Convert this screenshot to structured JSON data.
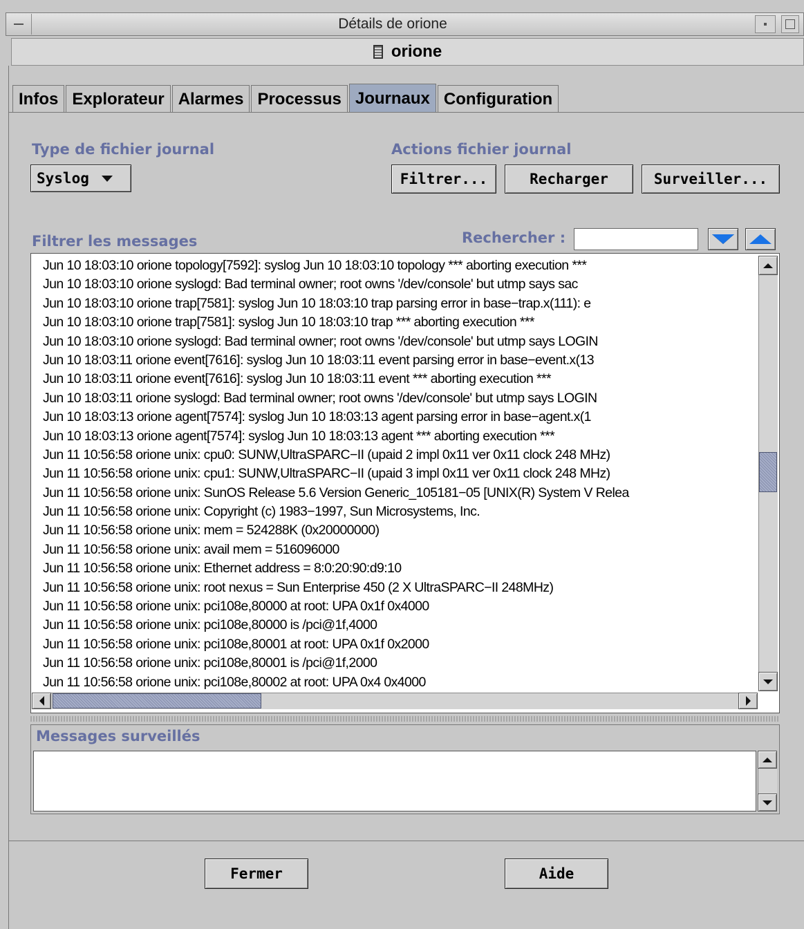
{
  "window": {
    "title": "Détails de orione",
    "host_name": "orione",
    "host_icon": "host-icon"
  },
  "tabs": [
    {
      "label": "Infos",
      "active": false
    },
    {
      "label": "Explorateur",
      "active": false
    },
    {
      "label": "Alarmes",
      "active": false
    },
    {
      "label": "Processus",
      "active": false
    },
    {
      "label": "Journaux",
      "active": true
    },
    {
      "label": "Configuration",
      "active": false
    }
  ],
  "log_type": {
    "label": "Type de fichier journal",
    "selected": "Syslog"
  },
  "log_actions": {
    "label": "Actions fichier journal",
    "filter": "Filtrer...",
    "reload": "Recharger",
    "watch": "Surveiller..."
  },
  "filter_messages": {
    "label": "Filtrer les messages",
    "search_label": "Rechercher :",
    "search_value": ""
  },
  "log_lines": [
    "Jun 10 18:03:10 orione topology[7592]: syslog  Jun 10 18:03:10 topology     *** aborting execution ***",
    "Jun 10 18:03:10 orione syslogd: Bad terminal owner; root owns '/dev/console' but utmp says sac",
    "Jun 10 18:03:10 orione trap[7581]: syslog  Jun 10 18:03:10 trap        parsing error in base−trap.x(111): e",
    "Jun 10 18:03:10 orione trap[7581]: syslog  Jun 10 18:03:10 trap        *** aborting execution ***",
    "Jun 10 18:03:10 orione syslogd: Bad terminal owner; root owns '/dev/console' but utmp says LOGIN",
    "Jun 10 18:03:11 orione event[7616]: syslog  Jun 10 18:03:11 event       parsing error in base−event.x(13",
    "Jun 10 18:03:11 orione event[7616]: syslog  Jun 10 18:03:11 event       *** aborting execution ***",
    "Jun 10 18:03:11 orione syslogd: Bad terminal owner; root owns '/dev/console' but utmp says LOGIN",
    "Jun 10 18:03:13 orione agent[7574]: syslog  Jun 10 18:03:13 agent       parsing error in base−agent.x(1",
    "Jun 10 18:03:13 orione agent[7574]: syslog  Jun 10 18:03:13 agent       *** aborting execution ***",
    "Jun 11 10:56:58 orione unix: cpu0: SUNW,UltraSPARC−II (upaid 2 impl 0x11 ver 0x11 clock 248 MHz)",
    "Jun 11 10:56:58 orione unix: cpu1: SUNW,UltraSPARC−II (upaid 3 impl 0x11 ver 0x11 clock 248 MHz)",
    "Jun 11 10:56:58 orione unix: SunOS Release 5.6 Version Generic_105181−05 [UNIX(R) System V Relea",
    "Jun 11 10:56:58 orione unix: Copyright (c) 1983−1997, Sun Microsystems, Inc.",
    "Jun 11 10:56:58 orione unix: mem = 524288K (0x20000000)",
    "Jun 11 10:56:58 orione unix: avail mem = 516096000",
    "Jun 11 10:56:58 orione unix: Ethernet address = 8:0:20:90:d9:10",
    "Jun 11 10:56:58 orione unix: root nexus = Sun Enterprise 450 (2 X UltraSPARC−II 248MHz)",
    "Jun 11 10:56:58 orione unix: pci108e,80000 at root: UPA 0x1f 0x4000",
    "Jun 11 10:56:58 orione unix: pci108e,80000 is /pci@1f,4000",
    "Jun 11 10:56:58 orione unix: pci108e,80001 at root: UPA 0x1f 0x2000",
    "Jun 11 10:56:58 orione unix: pci108e,80001 is /pci@1f,2000",
    "Jun 11 10:56:58 orione unix: pci108e,80002 at root: UPA 0x4 0x4000"
  ],
  "watched_messages": {
    "label": "Messages surveillés"
  },
  "footer": {
    "close": "Fermer",
    "help": "Aide"
  },
  "colors": {
    "group_label": "#6670a2",
    "active_tab": "#9eaac0",
    "arrow_button": "#1a73e6",
    "scroll_thumb": "#a6aec8"
  }
}
